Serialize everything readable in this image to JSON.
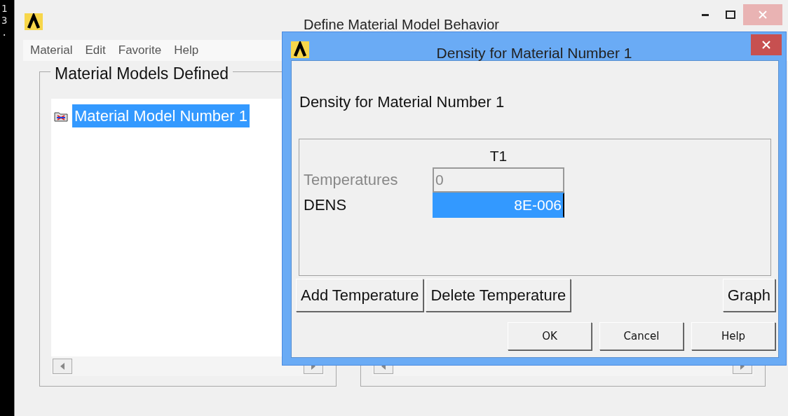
{
  "console": {
    "lines": [
      "1",
      "3",
      "."
    ]
  },
  "main_window": {
    "title": "Define Material Model Behavior",
    "menu": [
      "Material",
      "Edit",
      "Favorite",
      "Help"
    ],
    "models_group": {
      "title": "Material Models Defined",
      "items": [
        {
          "label": "Material Model Number 1",
          "selected": true
        }
      ]
    }
  },
  "dialog": {
    "title": "Density for Material Number 1",
    "heading": "Density for Material Number 1",
    "table": {
      "columns": [
        "T1"
      ],
      "rows": [
        {
          "label": "Temperatures",
          "value": "0",
          "disabled": true,
          "selected": false
        },
        {
          "label": "DENS",
          "value": "8E-006",
          "disabled": false,
          "selected": true
        }
      ]
    },
    "table_buttons": [
      "Add Temperature",
      "Delete Temperature",
      "Graph"
    ],
    "buttons": [
      "OK",
      "Cancel",
      "Help"
    ]
  }
}
